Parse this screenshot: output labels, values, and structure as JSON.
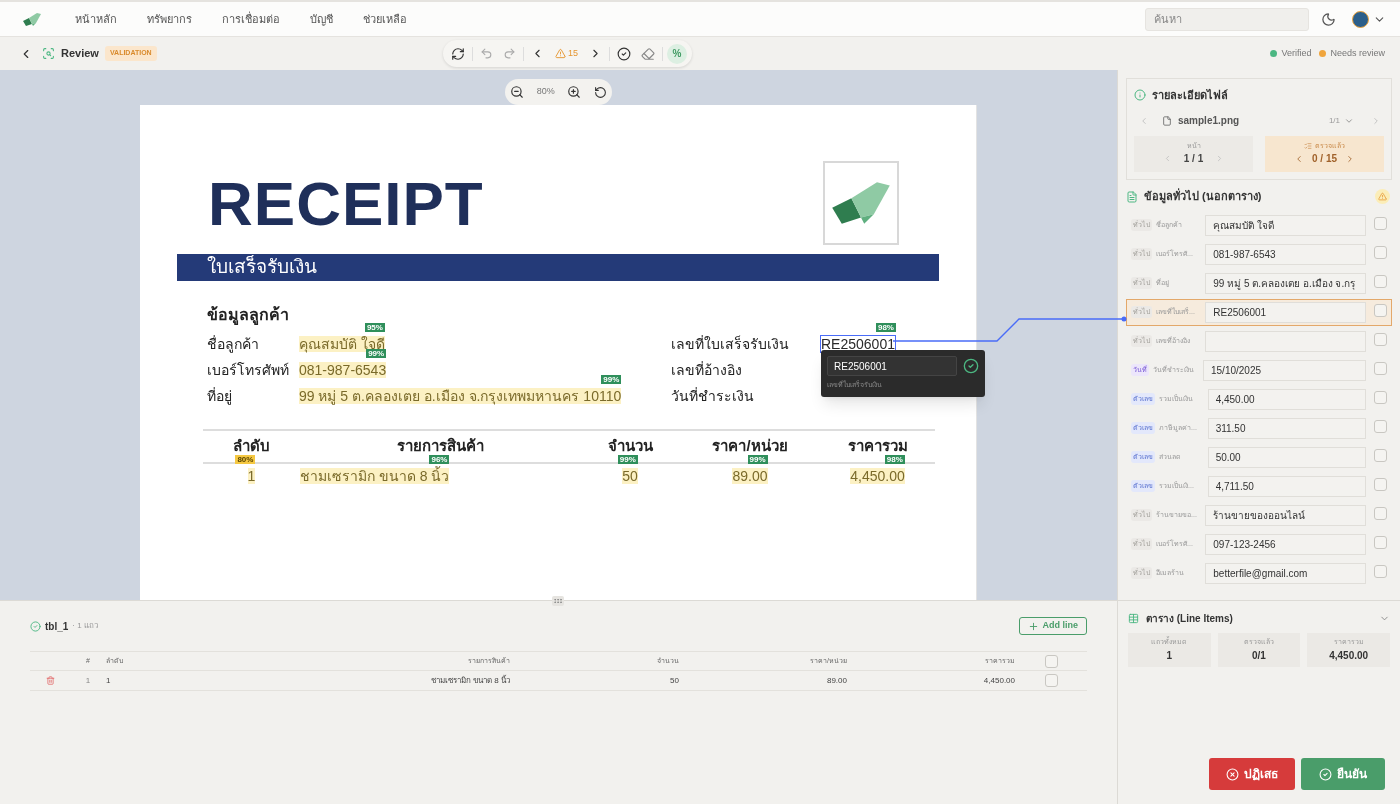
{
  "nav": {
    "items": [
      "หน้าหลัก",
      "ทรัพยากร",
      "การเชื่อมต่อ",
      "บัญชี",
      "ช่วยเหลือ"
    ],
    "search": {
      "placeholder": "ค้นหา"
    }
  },
  "toolbar": {
    "title": "Review",
    "badge": "VALIDATION",
    "warning_count": "15",
    "percent_toggle": {
      "label": "%",
      "on": true
    },
    "legend": [
      {
        "label": "Verified",
        "color": "#4cb782"
      },
      {
        "label": "Needs review",
        "color": "#f0a53c"
      }
    ]
  },
  "zoom": "80%",
  "document": {
    "title": "RECEIPT",
    "subtitle": "ใบเสร็จรับเงิน",
    "section": "ข้อมูลลูกค้า",
    "left_fields": [
      {
        "label": "ชื่อลูกค้า",
        "value": "คุณสมบัติ ใจดี",
        "confidence": "95%",
        "needs_review": false
      },
      {
        "label": "เบอร์โทรศัพท์",
        "value": "081-987-6543",
        "confidence": "99%",
        "needs_review": false
      },
      {
        "label": "ที่อยู่",
        "value": "99 หมู่ 5 ต.คลองเตย อ.เมือง จ.กรุงเทพมหานคร 10110",
        "confidence": "99%",
        "needs_review": false
      }
    ],
    "right_fields": [
      {
        "label": "เลขที่ใบเสร็จรับเงิน",
        "value": "RE2506001",
        "confidence": "98%",
        "needs_review": false,
        "selected": true
      },
      {
        "label": "เลขที่อ้างอิง"
      },
      {
        "label": "วันที่ชำระเงิน"
      }
    ],
    "table": {
      "columns": [
        "ลำดับ",
        "รายการสินค้า",
        "จำนวน",
        "ราคา/หน่วย",
        "ราคารวม"
      ],
      "rows": [
        [
          {
            "text": "1",
            "confidence": "80%",
            "needs_review": true
          },
          {
            "text": "ชามเซรามิก ขนาด 8 นิ้ว",
            "confidence": "96%",
            "needs_review": false
          },
          {
            "text": "50",
            "confidence": "99%",
            "needs_review": false
          },
          {
            "text": "89.00",
            "confidence": "99%",
            "needs_review": false
          },
          {
            "text": "4,450.00",
            "confidence": "98%",
            "needs_review": false
          }
        ]
      ]
    }
  },
  "tooltip": {
    "value": "RE2506001",
    "caption": "เลขที่ใบเสร็จรับเงิน",
    "verified": true
  },
  "bottom_table": {
    "name": "tbl_1",
    "count": "· 1 แถว",
    "add_button": "Add line",
    "columns": [
      "#",
      "ลำดับ",
      "รายการสินค้า",
      "จำนวน",
      "ราคา/หน่วย",
      "ราคารวม"
    ],
    "header_checked": false,
    "rows": [
      {
        "cells": [
          "1",
          "1",
          "ชามเซรามิก ขนาด 8 นิ้ว",
          "50",
          "89.00",
          "4,450.00"
        ],
        "checked": false
      }
    ]
  },
  "side": {
    "file_title": "รายละเอียดไฟล์",
    "file_name": "sample1.png",
    "file_count": "1/1",
    "page_label": "หน้า",
    "page": "1 / 1",
    "checked_label": "ตรวจแล้ว",
    "checked": "0 / 15",
    "general_title": "ข้อมูลทั่วไป (นอกตาราง)",
    "fields": [
      {
        "tag": "ทั่วไป",
        "kind": "text",
        "label": "ชื่อลูกค้า",
        "value": "คุณสมบัติ ใจดี",
        "checked": false,
        "selected": false
      },
      {
        "tag": "ทั่วไป",
        "kind": "text",
        "label": "เบอร์โทรศั...",
        "value": "081-987-6543",
        "checked": false,
        "selected": false
      },
      {
        "tag": "ทั่วไป",
        "kind": "text",
        "label": "ที่อยู่",
        "value": "99 หมู่ 5 ต.คลองเตย อ.เมือง จ.กรุ",
        "checked": false,
        "selected": false
      },
      {
        "tag": "ทั่วไป",
        "kind": "text",
        "label": "เลขที่ใบเสร็...",
        "value": "RE2506001",
        "checked": false,
        "selected": true
      },
      {
        "tag": "ทั่วไป",
        "kind": "text",
        "label": "เลขที่อ้างอิง",
        "checked": false,
        "selected": false
      },
      {
        "tag": "วันที่",
        "kind": "date",
        "label": "วันที่ชำระเงิน",
        "value": "15/10/2025",
        "checked": false,
        "selected": false
      },
      {
        "tag": "ตัวเลข",
        "kind": "number",
        "label": "รวมเป็นเงิน",
        "value": "4,450.00",
        "checked": false,
        "selected": false
      },
      {
        "tag": "ตัวเลข",
        "kind": "number",
        "label": "ภาษีมูลค่า...",
        "value": "311.50",
        "checked": false,
        "selected": false
      },
      {
        "tag": "ตัวเลข",
        "kind": "number",
        "label": "ส่วนลด",
        "value": "50.00",
        "checked": false,
        "selected": false
      },
      {
        "tag": "ตัวเลข",
        "kind": "number",
        "label": "รวมเป็นเงิ...",
        "value": "4,711.50",
        "checked": false,
        "selected": false
      },
      {
        "tag": "ทั่วไป",
        "kind": "text",
        "label": "ร้านขายขอ...",
        "value": "ร้านขายของออนไลน์",
        "checked": false,
        "selected": false
      },
      {
        "tag": "ทั่วไป",
        "kind": "text",
        "label": "เบอร์โทรศั...",
        "value": "097-123-2456",
        "checked": false,
        "selected": false
      },
      {
        "tag": "ทั่วไป",
        "kind": "text",
        "label": "อีเมลร้าน",
        "value": "betterfile@gmail.com",
        "checked": false,
        "selected": false
      }
    ],
    "line_items_title": "ตาราง (Line Items)",
    "line_stats": [
      {
        "label": "แถวทั้งหมด",
        "value": "1"
      },
      {
        "label": "ตรวจแล้ว",
        "value": "0/1"
      },
      {
        "label": "ราคารวม",
        "value": "4,450.00"
      }
    ],
    "reject": "ปฏิเสธ",
    "confirm": "ยืนยัน"
  }
}
